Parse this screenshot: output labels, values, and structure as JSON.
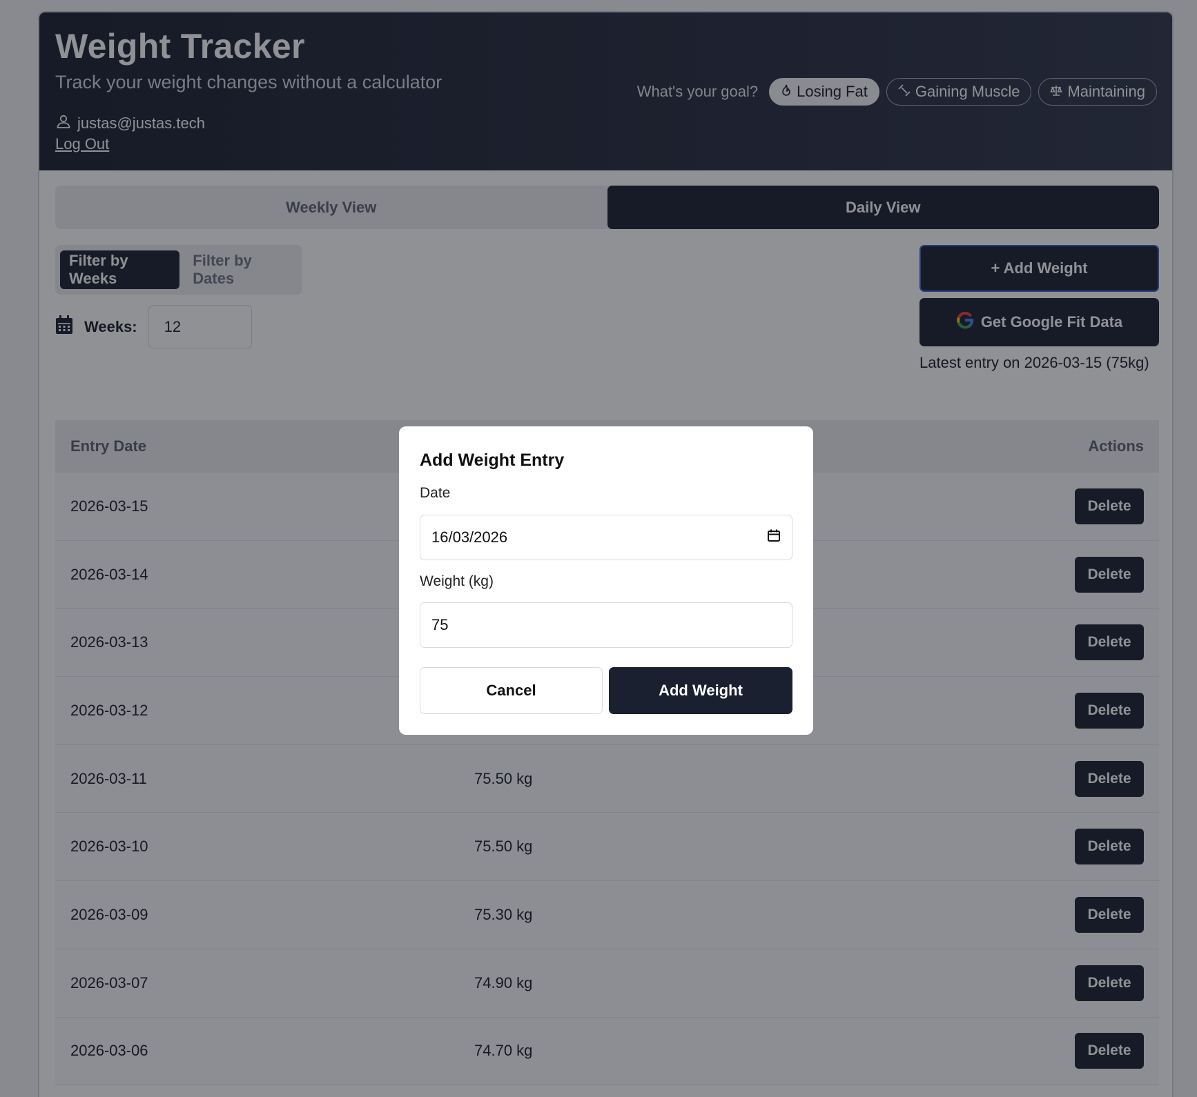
{
  "header": {
    "title": "Weight Tracker",
    "subtitle": "Track your weight changes without a calculator",
    "user_email": "justas@justas.tech",
    "logout_label": "Log Out",
    "goal_label": "What's your goal?",
    "goals": [
      {
        "label": "Losing Fat",
        "icon": "flame-icon",
        "active": true
      },
      {
        "label": "Gaining Muscle",
        "icon": "dumbbell-icon",
        "active": false
      },
      {
        "label": "Maintaining",
        "icon": "scale-icon",
        "active": false
      }
    ]
  },
  "view_tabs": {
    "weekly": "Weekly View",
    "daily": "Daily View",
    "active": "daily"
  },
  "filter_tabs": {
    "weeks": "Filter by Weeks",
    "dates": "Filter by Dates",
    "active": "weeks"
  },
  "weeks_filter": {
    "label": "Weeks:",
    "value": "12"
  },
  "actions": {
    "add_weight": "+ Add Weight",
    "google_fit": "Get Google Fit Data",
    "latest_entry": "Latest entry on 2026-03-15 (75kg)"
  },
  "table": {
    "headers": {
      "date": "Entry Date",
      "actions": "Actions"
    },
    "delete_label": "Delete",
    "rows": [
      {
        "date": "2026-03-15",
        "weight": ""
      },
      {
        "date": "2026-03-14",
        "weight": ""
      },
      {
        "date": "2026-03-13",
        "weight": ""
      },
      {
        "date": "2026-03-12",
        "weight": ""
      },
      {
        "date": "2026-03-11",
        "weight": "75.50 kg"
      },
      {
        "date": "2026-03-10",
        "weight": "75.50 kg"
      },
      {
        "date": "2026-03-09",
        "weight": "75.30 kg"
      },
      {
        "date": "2026-03-07",
        "weight": "74.90 kg"
      },
      {
        "date": "2026-03-06",
        "weight": "74.70 kg"
      }
    ]
  },
  "modal": {
    "title": "Add Weight Entry",
    "date_label": "Date",
    "date_value": "16/03/2026",
    "weight_label": "Weight (kg)",
    "weight_value": "75",
    "cancel_label": "Cancel",
    "submit_label": "Add Weight"
  },
  "colors": {
    "primary_dark": "#1b2030",
    "accent_focus": "#3b63d8",
    "overlay": "rgba(20,22,30,0.47)"
  }
}
